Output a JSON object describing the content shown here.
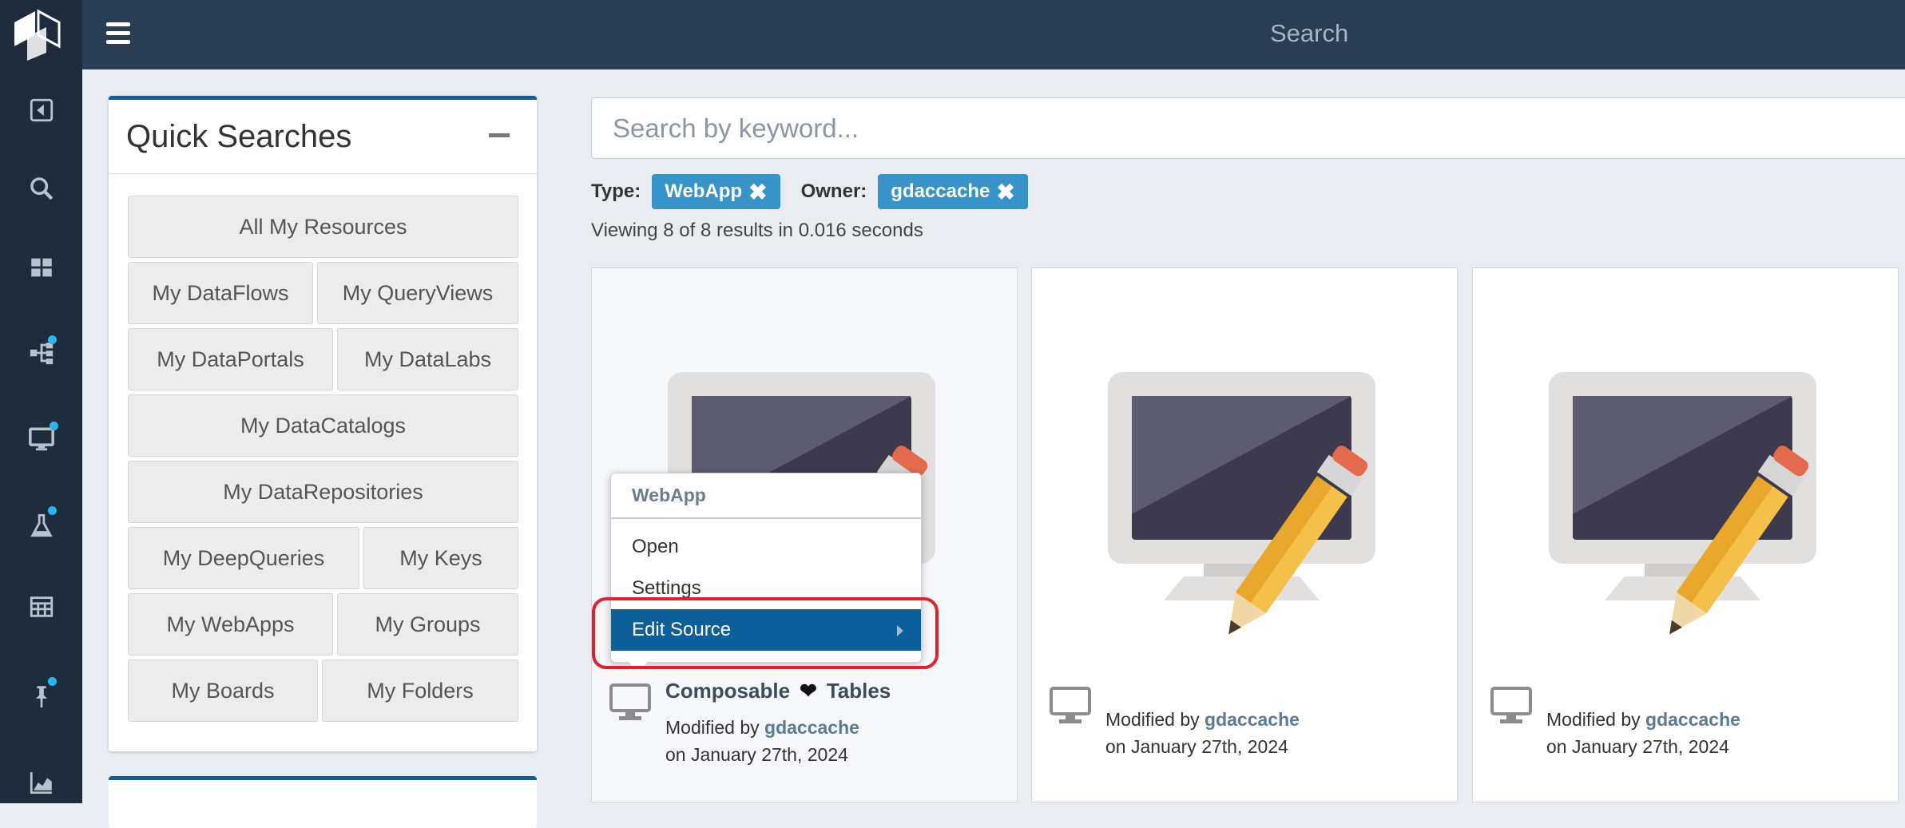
{
  "topbar": {
    "title": "Search"
  },
  "quick_searches": {
    "title": "Quick Searches",
    "rows": [
      [
        "All My Resources"
      ],
      [
        "My DataFlows",
        "My QueryViews"
      ],
      [
        "My DataPortals",
        "My DataLabs"
      ],
      [
        "My DataCatalogs"
      ],
      [
        "My DataRepositories"
      ],
      [
        "My DeepQueries",
        "My Keys"
      ],
      [
        "My WebApps",
        "My Groups"
      ],
      [
        "My Boards",
        "My Folders"
      ]
    ]
  },
  "search": {
    "placeholder": "Search by keyword..."
  },
  "filters": {
    "type_label": "Type:",
    "type_value": "WebApp",
    "owner_label": "Owner:",
    "owner_value": "gdaccache",
    "remove_glyph": "✖"
  },
  "results": {
    "summary": "Viewing 8 of 8 results in 0.016 seconds"
  },
  "cards": [
    {
      "name_left": "Composable",
      "heart": "❤",
      "name_right": "Tables",
      "modified_by": "Modified by",
      "user": "gdaccache",
      "date": "on January 27th, 2024"
    },
    {
      "modified_by": "Modified by",
      "user": "gdaccache",
      "date": "on January 27th, 2024"
    },
    {
      "modified_by": "Modified by",
      "user": "gdaccache",
      "date": "on January 27th, 2024"
    }
  ],
  "context_menu": {
    "header": "WebApp",
    "items": [
      "Open",
      "Settings",
      "Edit Source"
    ]
  },
  "icons": [
    "logo-icon",
    "collapse-icon",
    "search-icon",
    "dashboard-icon",
    "dataflow-icon",
    "monitor-icon",
    "flask-icon",
    "table-icon",
    "pin-icon",
    "chart-icon",
    "webapp-icon"
  ],
  "colors": {
    "accent": "#3794c9",
    "menu_active": "#0d5f9a",
    "highlight": "#e0202a",
    "badge_dot": "#2cb5ea"
  }
}
